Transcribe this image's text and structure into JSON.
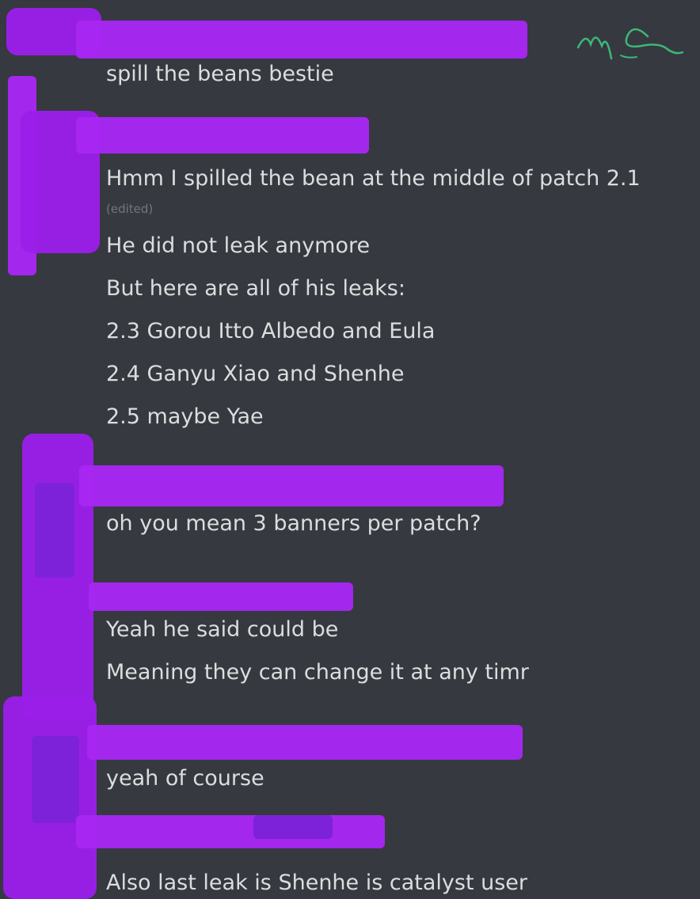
{
  "messages": [
    {
      "text": "spill the beans bestie"
    },
    {
      "text": "Hmm I spilled the bean at the middle of patch 2.1",
      "edited": "(edited)"
    },
    {
      "text": "He did not leak anymore"
    },
    {
      "text": "But here are all of his leaks:"
    },
    {
      "text": "2.3 Gorou Itto Albedo and Eula"
    },
    {
      "text": "2.4 Ganyu Xiao and Shenhe"
    },
    {
      "text": "2.5 maybe Yae"
    },
    {
      "text": "oh you mean 3 banners per patch?"
    },
    {
      "text": "Yeah he said could be"
    },
    {
      "text": "Meaning they can change it at any timr"
    },
    {
      "text": "yeah of course"
    },
    {
      "text": "Also last leak is Shenhe is catalyst user"
    }
  ],
  "annotation": {
    "handwritten": "me",
    "color": "#3cb878"
  },
  "colors": {
    "background": "#36393f",
    "text": "#dcddde",
    "muted": "#72767d",
    "redaction": "#a726f2"
  }
}
